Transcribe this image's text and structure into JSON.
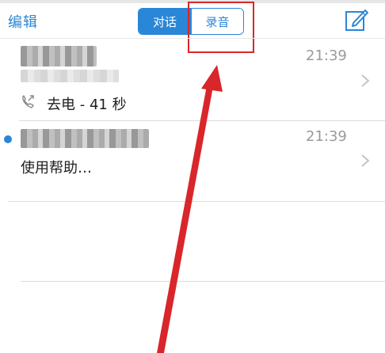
{
  "nav": {
    "edit_label": "编辑",
    "segment": {
      "left_label": "对话",
      "right_label": "录音"
    },
    "compose_icon": "compose-icon"
  },
  "rows": [
    {
      "time": "21:39",
      "detail": "去电 - 41 秒",
      "icon": "outgoing-call-icon",
      "unread": false
    },
    {
      "time": "21:39",
      "detail": "使用帮助…",
      "unread": true
    }
  ],
  "colors": {
    "accent": "#2a86d6",
    "annotation_red": "#d9262a",
    "divider": "#dddddd",
    "time_gray": "#9a9a9a"
  }
}
